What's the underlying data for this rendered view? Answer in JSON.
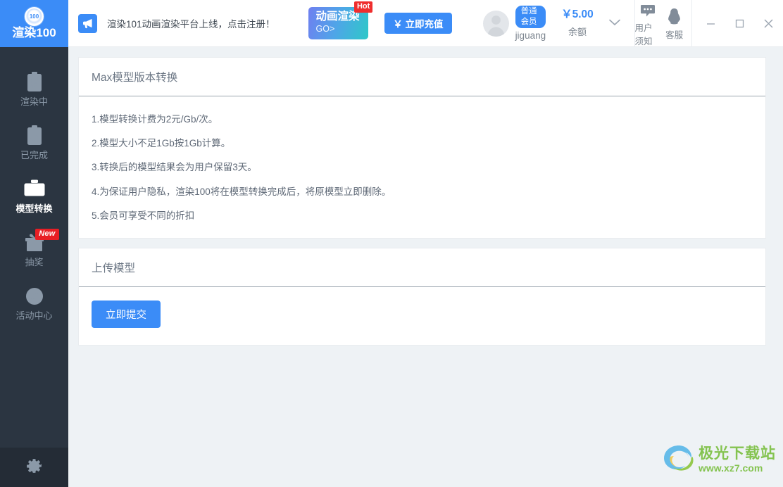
{
  "app": {
    "logo_text": "渲染100",
    "logo_mark_text": "100"
  },
  "sidebar": {
    "items": [
      {
        "label": "渲染中",
        "icon": "clipboard-clock-icon",
        "active": false
      },
      {
        "label": "已完成",
        "icon": "clipboard-check-icon",
        "active": false
      },
      {
        "label": "模型转换",
        "icon": "briefcase-icon",
        "active": true
      },
      {
        "label": "抽奖",
        "icon": "gift-icon",
        "active": false,
        "badge": "New"
      },
      {
        "label": "活动中心",
        "icon": "compass-icon",
        "active": false
      }
    ],
    "settings_icon": "gear-icon"
  },
  "topbar": {
    "announcement": {
      "icon": "megaphone-icon",
      "text": "渲染101动画渲染平台上线，点击注册！"
    },
    "promo": {
      "title": "动画渲染",
      "subtitle": "GO>",
      "badge": "Hot"
    },
    "recharge_label": "￥ 立即充值",
    "user": {
      "avatar_icon": "user-avatar-icon",
      "vip_badge": "普通会员",
      "name": "jiguang"
    },
    "balance": {
      "amount": "￥5.00",
      "label": "余额"
    },
    "dropdown_icon": "chevron-down-icon",
    "tools": [
      {
        "label": "用户须知",
        "icon": "speech-bubble-icon"
      },
      {
        "label": "客服",
        "icon": "qq-penguin-icon"
      }
    ],
    "window_controls": [
      {
        "name": "minimize",
        "icon": "minimize-icon"
      },
      {
        "name": "maximize",
        "icon": "maximize-icon"
      },
      {
        "name": "close",
        "icon": "close-icon"
      }
    ]
  },
  "main": {
    "notice_card": {
      "title": "Max模型版本转换",
      "rules": [
        "1.模型转换计费为2元/Gb/次。",
        "2.模型大小不足1Gb按1Gb计算。",
        "3.转换后的模型结果会为用户保留3天。",
        "4.为保证用户隐私，渲染100将在模型转换完成后，将原模型立即删除。",
        "5.会员可享受不同的折扣"
      ]
    },
    "upload_card": {
      "title": "上传模型",
      "submit_label": "立即提交"
    }
  },
  "watermark": {
    "title": "极光下载站",
    "url": "www.xz7.com"
  },
  "colors": {
    "accent": "#3b8cf7",
    "sidebar_bg": "#2b3541",
    "sidebar_footer_bg": "#242c36",
    "content_bg": "#eef2f5",
    "hot_badge": "#ef2e2e",
    "new_badge": "#e81e25",
    "watermark_green": "#7cc043"
  }
}
